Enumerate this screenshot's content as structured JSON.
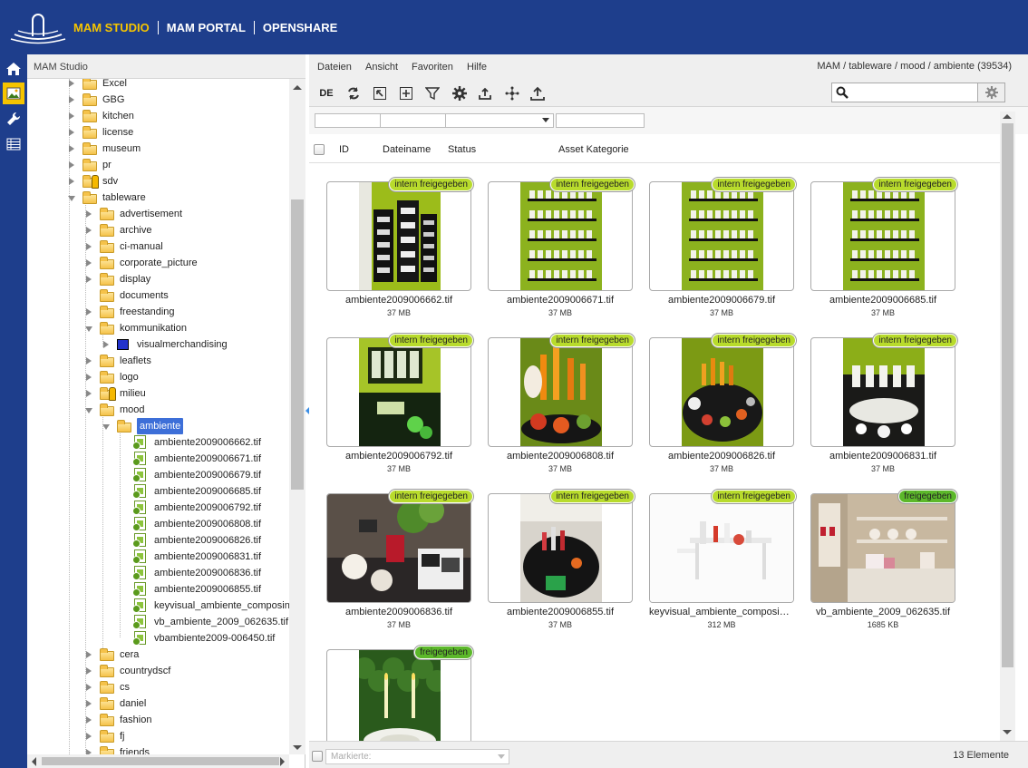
{
  "header": {
    "nav": [
      {
        "label": "MAM STUDIO",
        "active": true
      },
      {
        "label": "MAM PORTAL",
        "active": false
      },
      {
        "label": "OPENSHARE",
        "active": false
      }
    ]
  },
  "left_toolbar": [
    "home-icon",
    "image-icon",
    "wrench-icon",
    "list-icon"
  ],
  "tree": {
    "title": "MAM Studio",
    "items": [
      {
        "label": "Excel",
        "depth": 0,
        "state": "c",
        "icon": "folder"
      },
      {
        "label": "GBG",
        "depth": 0,
        "state": "c",
        "icon": "folder"
      },
      {
        "label": "kitchen",
        "depth": 0,
        "state": "c",
        "icon": "folder"
      },
      {
        "label": "license",
        "depth": 0,
        "state": "c",
        "icon": "folder"
      },
      {
        "label": "museum",
        "depth": 0,
        "state": "c",
        "icon": "folder"
      },
      {
        "label": "pr",
        "depth": 0,
        "state": "c",
        "icon": "folder"
      },
      {
        "label": "sdv",
        "depth": 0,
        "state": "c",
        "icon": "folder-locked"
      },
      {
        "label": "tableware",
        "depth": 0,
        "state": "e",
        "icon": "folder"
      },
      {
        "label": "advertisement",
        "depth": 1,
        "state": "c",
        "icon": "folder"
      },
      {
        "label": "archive",
        "depth": 1,
        "state": "c",
        "icon": "folder"
      },
      {
        "label": "ci-manual",
        "depth": 1,
        "state": "c",
        "icon": "folder"
      },
      {
        "label": "corporate_picture",
        "depth": 1,
        "state": "c",
        "icon": "folder"
      },
      {
        "label": "display",
        "depth": 1,
        "state": "c",
        "icon": "folder"
      },
      {
        "label": "documents",
        "depth": 1,
        "state": "n",
        "icon": "folder"
      },
      {
        "label": "freestanding",
        "depth": 1,
        "state": "c",
        "icon": "folder"
      },
      {
        "label": "kommunikation",
        "depth": 1,
        "state": "e",
        "icon": "folder"
      },
      {
        "label": "visualmerchandising",
        "depth": 2,
        "state": "c",
        "icon": "vm"
      },
      {
        "label": "leaflets",
        "depth": 1,
        "state": "c",
        "icon": "folder"
      },
      {
        "label": "logo",
        "depth": 1,
        "state": "c",
        "icon": "folder"
      },
      {
        "label": "milieu",
        "depth": 1,
        "state": "c",
        "icon": "folder-locked"
      },
      {
        "label": "mood",
        "depth": 1,
        "state": "e",
        "icon": "folder"
      },
      {
        "label": "ambiente",
        "depth": 2,
        "state": "e",
        "icon": "folder",
        "selected": true
      },
      {
        "label": "ambiente2009006662.tif",
        "depth": 3,
        "state": "n",
        "icon": "file"
      },
      {
        "label": "ambiente2009006671.tif",
        "depth": 3,
        "state": "n",
        "icon": "file"
      },
      {
        "label": "ambiente2009006679.tif",
        "depth": 3,
        "state": "n",
        "icon": "file"
      },
      {
        "label": "ambiente2009006685.tif",
        "depth": 3,
        "state": "n",
        "icon": "file"
      },
      {
        "label": "ambiente2009006792.tif",
        "depth": 3,
        "state": "n",
        "icon": "file"
      },
      {
        "label": "ambiente2009006808.tif",
        "depth": 3,
        "state": "n",
        "icon": "file"
      },
      {
        "label": "ambiente2009006826.tif",
        "depth": 3,
        "state": "n",
        "icon": "file"
      },
      {
        "label": "ambiente2009006831.tif",
        "depth": 3,
        "state": "n",
        "icon": "file"
      },
      {
        "label": "ambiente2009006836.tif",
        "depth": 3,
        "state": "n",
        "icon": "file"
      },
      {
        "label": "ambiente2009006855.tif",
        "depth": 3,
        "state": "n",
        "icon": "file"
      },
      {
        "label": "keyvisual_ambiente_composing",
        "depth": 3,
        "state": "n",
        "icon": "file"
      },
      {
        "label": "vb_ambiente_2009_062635.tif",
        "depth": 3,
        "state": "n",
        "icon": "file"
      },
      {
        "label": "vbambiente2009-006450.tif",
        "depth": 3,
        "state": "n",
        "icon": "file"
      },
      {
        "label": "cera",
        "depth": 1,
        "state": "c",
        "icon": "folder"
      },
      {
        "label": "countrydscf",
        "depth": 1,
        "state": "c",
        "icon": "folder"
      },
      {
        "label": "cs",
        "depth": 1,
        "state": "c",
        "icon": "folder"
      },
      {
        "label": "daniel",
        "depth": 1,
        "state": "c",
        "icon": "folder"
      },
      {
        "label": "fashion",
        "depth": 1,
        "state": "c",
        "icon": "folder"
      },
      {
        "label": "fj",
        "depth": 1,
        "state": "c",
        "icon": "folder"
      },
      {
        "label": "friends",
        "depth": 1,
        "state": "c",
        "icon": "folder"
      }
    ]
  },
  "menu": {
    "items": [
      "Dateien",
      "Ansicht",
      "Favoriten",
      "Hilfe"
    ],
    "breadcrumb": "MAM / tableware / mood / ambiente (39534)"
  },
  "toolbar": {
    "lang": "DE",
    "icons": [
      "refresh-icon",
      "open-parent-icon",
      "new-folder-icon",
      "filter-icon",
      "gear-icon",
      "upload-icon",
      "share-icon",
      "export-icon"
    ],
    "search_placeholder": ""
  },
  "columns": [
    "ID",
    "Dateiname",
    "Status",
    "Asset Kategorie"
  ],
  "assets": [
    {
      "name": "ambiente2009006662.tif",
      "size": "37 MB",
      "badge": "intern freigegeben",
      "badge_kind": "intern",
      "thumb": "display"
    },
    {
      "name": "ambiente2009006671.tif",
      "size": "37 MB",
      "badge": "intern freigegeben",
      "badge_kind": "intern",
      "thumb": "shelves"
    },
    {
      "name": "ambiente2009006679.tif",
      "size": "37 MB",
      "badge": "intern freigegeben",
      "badge_kind": "intern",
      "thumb": "shelves"
    },
    {
      "name": "ambiente2009006685.tif",
      "size": "37 MB",
      "badge": "intern freigegeben",
      "badge_kind": "intern",
      "thumb": "shelves"
    },
    {
      "name": "ambiente2009006792.tif",
      "size": "37 MB",
      "badge": "intern freigegeben",
      "badge_kind": "intern",
      "thumb": "glass"
    },
    {
      "name": "ambiente2009006808.tif",
      "size": "37 MB",
      "badge": "intern freigegeben",
      "badge_kind": "intern",
      "thumb": "candles"
    },
    {
      "name": "ambiente2009006826.tif",
      "size": "37 MB",
      "badge": "intern freigegeben",
      "badge_kind": "intern",
      "thumb": "table"
    },
    {
      "name": "ambiente2009006831.tif",
      "size": "37 MB",
      "badge": "intern freigegeben",
      "badge_kind": "intern",
      "thumb": "white"
    },
    {
      "name": "ambiente2009006836.tif",
      "size": "37 MB",
      "badge": "intern freigegeben",
      "badge_kind": "intern",
      "thumb": "wide-dining"
    },
    {
      "name": "ambiente2009006855.tif",
      "size": "37 MB",
      "badge": "intern freigegeben",
      "badge_kind": "intern",
      "thumb": "dark-table"
    },
    {
      "name": "keyvisual_ambiente_composing.tif",
      "size": "312 MB",
      "badge": "intern freigegeben",
      "badge_kind": "intern",
      "thumb": "keyvisual"
    },
    {
      "name": "vb_ambiente_2009_062635.tif",
      "size": "1685 KB",
      "badge": "freigegeben",
      "badge_kind": "frei",
      "thumb": "kitchen"
    },
    {
      "name": "vbambiente2009-006450.tif",
      "size": "",
      "badge": "freigegeben",
      "badge_kind": "frei",
      "thumb": "garden"
    }
  ],
  "status": {
    "mark_placeholder": "Markierte:",
    "count": "13 Elemente"
  },
  "colors": {
    "header": "#1e3e8c",
    "nav_active": "#f5c400",
    "badge_intern": "#b8db2c",
    "badge_frei": "#5cb82a",
    "selection": "#3d6fd8"
  }
}
